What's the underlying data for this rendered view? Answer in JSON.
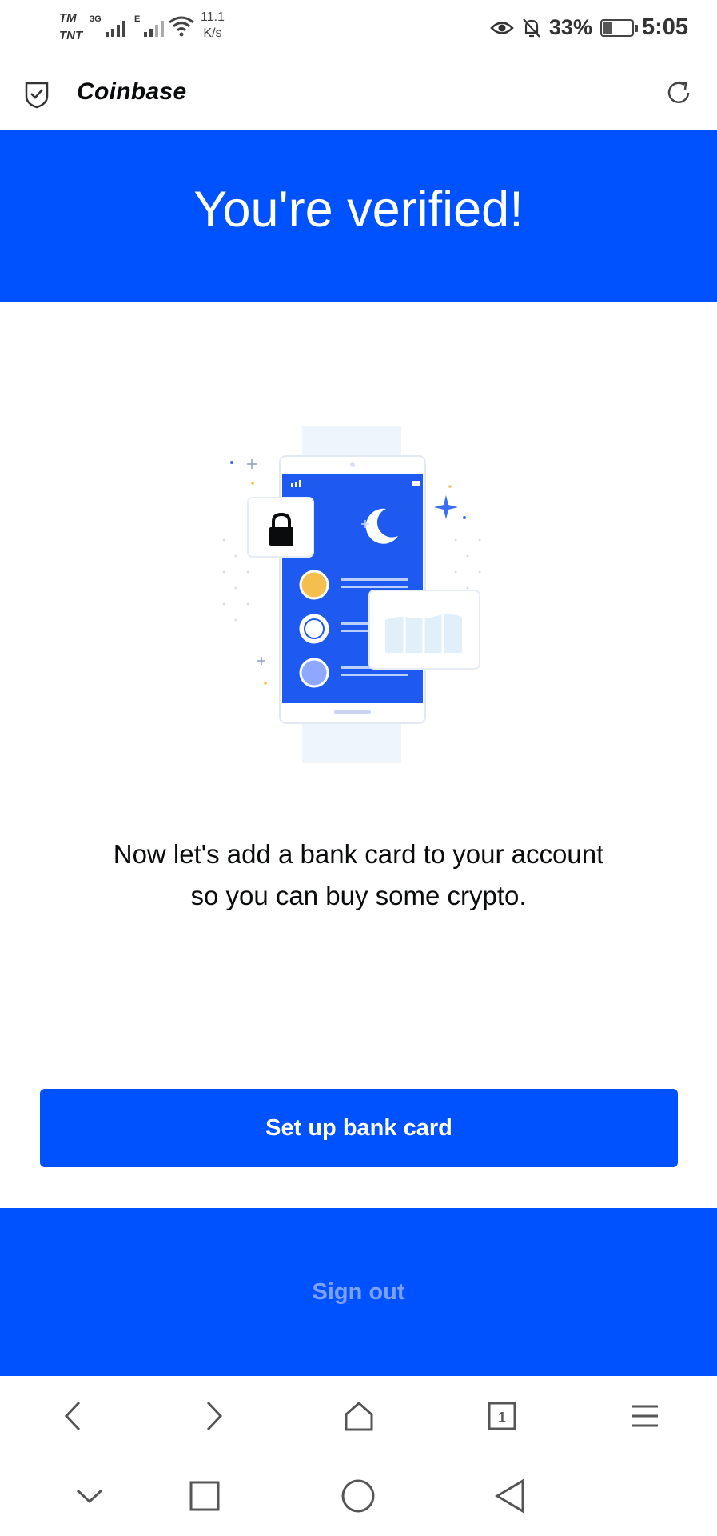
{
  "status_bar": {
    "carrier_1": "TM",
    "carrier_2": "TNT",
    "network_1": "3G",
    "network_2": "E",
    "speed_value": "11.1",
    "speed_unit": "K/s",
    "battery_percent": "33%",
    "time": "5:05",
    "icons": [
      "signal-icon",
      "wifi-icon",
      "eye-icon",
      "bell-muted-icon",
      "battery-icon"
    ]
  },
  "header": {
    "brand": "Coinbase",
    "icons": [
      "shield-check-icon",
      "reload-icon"
    ]
  },
  "banner": {
    "title": "You're verified!"
  },
  "illustration": {
    "icons": [
      "phone-icon",
      "lock-icon",
      "moon-icon",
      "sparkle-icon",
      "chart-card-icon"
    ],
    "accent_colors": [
      "#0052ff",
      "#f5bf4f",
      "#ffffff",
      "#8ea8ff"
    ]
  },
  "main": {
    "message_line1": "Now let's add a bank card to your account",
    "message_line2": "so you can buy some crypto.",
    "primary_button": "Set up bank card",
    "secondary_button": "Sign out"
  },
  "browser_nav": {
    "items": [
      "back-icon",
      "forward-icon",
      "home-icon",
      "tabs-icon",
      "menu-icon"
    ],
    "tab_count": "1"
  },
  "system_nav": {
    "items": [
      "collapse-icon",
      "recents-icon",
      "home-circle-icon",
      "back-triangle-icon"
    ]
  },
  "colors": {
    "brand_blue": "#0052ff",
    "text": "#0a0b0d",
    "signout_text": "#7ba0ff"
  }
}
